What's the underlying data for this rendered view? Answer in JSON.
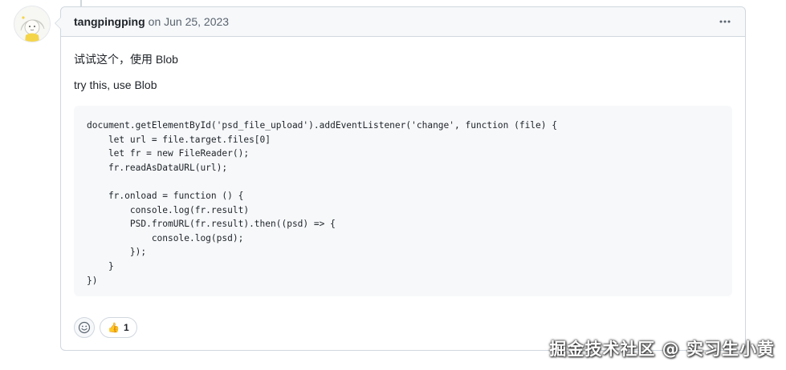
{
  "comment": {
    "author": "tangpingping",
    "date_text": "on Jun 25, 2023",
    "more_icon": "kebab-horizontal-icon",
    "body": {
      "paragraph_zh": "试试这个，使用 Blob",
      "paragraph_en": "try this, use Blob",
      "code": "document.getElementById('psd_file_upload').addEventListener('change', function (file) {\n    let url = file.target.files[0]\n    let fr = new FileReader();\n    fr.readAsDataURL(url);\n\n    fr.onload = function () {\n        console.log(fr.result)\n        PSD.fromURL(fr.result).then((psd) => {\n            console.log(psd);\n        });\n    }\n})"
    },
    "reactions": {
      "picker_icon": "smiley-icon",
      "items": [
        {
          "emoji": "👍",
          "icon": "thumbs-up-icon",
          "count": "1"
        }
      ]
    }
  },
  "watermark": "掘金技术社区 @ 实习生小黄",
  "colors": {
    "border": "#d0d7de",
    "header_bg": "#f6f8fa",
    "text": "#1f2328",
    "muted": "#59636e",
    "code_bg": "#f6f8fa"
  }
}
